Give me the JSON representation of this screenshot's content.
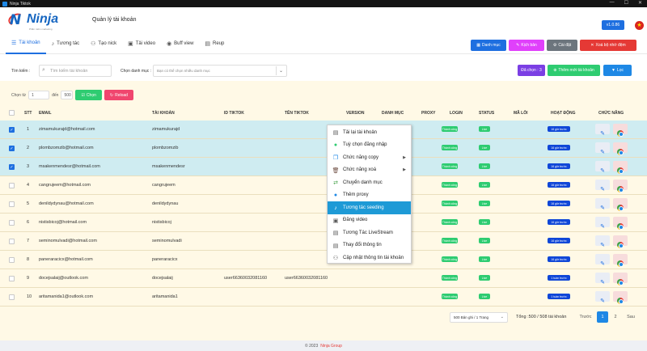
{
  "window": {
    "title": "Ninja Tiktok",
    "controls": [
      "—",
      "☐",
      "✕"
    ]
  },
  "app": {
    "logo_text": "Ninja",
    "logo_tagline": "Phần mềm marketing",
    "page_title": "Quản lý tài khoản",
    "version": "v1.0.86"
  },
  "tabs": [
    {
      "label": "Tài khoản",
      "icon": "list-icon",
      "glyph": "☰"
    },
    {
      "label": "Tương tác",
      "icon": "tiktok-icon",
      "glyph": "♪"
    },
    {
      "label": "Tạo nick",
      "icon": "user-add-icon",
      "glyph": "⚇"
    },
    {
      "label": "Tải video",
      "icon": "video-icon",
      "glyph": "▣"
    },
    {
      "label": "Buff view",
      "icon": "eye-icon",
      "glyph": "◉"
    },
    {
      "label": "Reup",
      "icon": "reup-icon",
      "glyph": "▤"
    }
  ],
  "top_buttons": [
    {
      "label": "Danh mục",
      "color": "#1e6fe0",
      "glyph": "▦"
    },
    {
      "label": "Kịch bản",
      "color": "#e040fb",
      "glyph": "✎"
    },
    {
      "label": "Cài đặt",
      "color": "#6c757d",
      "glyph": "⚙"
    },
    {
      "label": "Xoá bộ nhớ đệm",
      "color": "#e53935",
      "glyph": "✕"
    }
  ],
  "filters": {
    "search_label": "Tìm kiếm :",
    "search_placeholder": "Tìm kiếm tài khoản",
    "category_label": "Chọn danh mục :",
    "category_placeholder": "Bạn có thể chọn nhiều danh mục",
    "selected_badge": "Đã chọn : 3",
    "add_button": "Thêm mới tài khoản",
    "filter_button": "Lọc"
  },
  "range": {
    "from_label": "Chọn từ",
    "from_value": "1",
    "to_label": "đến",
    "to_value": "500",
    "select_button": "Chọn",
    "reload_button": "Reload"
  },
  "columns": [
    "STT",
    "EMAIL",
    "TÀI KHOẢN",
    "ID TIKTOK",
    "TÊN TIKTOK",
    "VERSION",
    "DANH MỤC",
    "PROXY",
    "LOGIN",
    "STATUS",
    "MÃ LỖI",
    "HOẠT ĐỘNG",
    "CHỨC NĂNG"
  ],
  "rows": [
    {
      "stt": "1",
      "email": "zimamukurajd@hotmail.com",
      "account": "zimamukurajd",
      "id_tiktok": "",
      "name_tiktok": "",
      "checked": true,
      "login": "Thành công",
      "status": "Live",
      "activity": "16 giờ trước"
    },
    {
      "stt": "2",
      "email": "plombzomzib@hotmail.com",
      "account": "plombzomzib",
      "id_tiktok": "",
      "name_tiktok": "",
      "checked": true,
      "login": "Thành công",
      "status": "Live",
      "activity": "16 giờ trước"
    },
    {
      "stt": "3",
      "email": "msakenmendesr@hotmail.com",
      "account": "msakenmendesr",
      "id_tiktok": "",
      "name_tiktok": "",
      "checked": true,
      "login": "Thành công",
      "status": "Live",
      "activity": "16 giờ trước"
    },
    {
      "stt": "4",
      "email": "cangrujeem@hotmail.com",
      "account": "cangrujeem",
      "id_tiktok": "",
      "name_tiktok": "",
      "checked": false,
      "login": "Thành công",
      "status": "Live",
      "activity": "16 giờ trước"
    },
    {
      "stt": "5",
      "email": "denildydynau@hotmail.com",
      "account": "denildydynau",
      "id_tiktok": "",
      "name_tiktok": "",
      "checked": false,
      "login": "Thành công",
      "status": "Live",
      "activity": "16 giờ trước"
    },
    {
      "stt": "6",
      "email": "nistisbicoj@hotmail.com",
      "account": "nistisbicoj",
      "id_tiktok": "",
      "name_tiktok": "",
      "checked": false,
      "login": "Thành công",
      "status": "Live",
      "activity": "16 giờ trước"
    },
    {
      "stt": "7",
      "email": "seminomulvadi@hotmail.com",
      "account": "seminomulvadi",
      "id_tiktok": "",
      "name_tiktok": "",
      "checked": false,
      "login": "Thành công",
      "status": "Live",
      "activity": "16 giờ trước"
    },
    {
      "stt": "8",
      "email": "paneraracicx@hotmail.com",
      "account": "paneraracicx",
      "id_tiktok": "",
      "name_tiktok": "",
      "checked": false,
      "login": "Thành công",
      "status": "Live",
      "activity": "16 giờ trước"
    },
    {
      "stt": "9",
      "email": "docejsalaij@outlook.com",
      "account": "docejsalaij",
      "id_tiktok": "user66360032081160",
      "name_tiktok": "user66360032081160",
      "checked": false,
      "login": "Thành công",
      "status": "Live",
      "activity": "1 tuần trước"
    },
    {
      "stt": "10",
      "email": "aritamanida1@outlook.com",
      "account": "aritamanida1",
      "id_tiktok": "",
      "name_tiktok": "",
      "checked": false,
      "login": "Thành công",
      "status": "Live",
      "activity": "1 tuần trước"
    }
  ],
  "context_menu": [
    {
      "label": "Tải lại tài khoản",
      "icon": "reload-icon",
      "glyph": "▤",
      "color": "#555"
    },
    {
      "label": "Tuỳ chọn đăng nhập",
      "icon": "login-option-icon",
      "glyph": "●",
      "color": "#2ecc71"
    },
    {
      "label": "Chức năng copy",
      "icon": "copy-icon",
      "glyph": "❐",
      "color": "#1e88e5",
      "submenu": true
    },
    {
      "label": "Chức năng xoá",
      "icon": "trash-icon",
      "glyph": "🗑",
      "color": "#6d4c41",
      "submenu": true
    },
    {
      "label": "Chuyển danh mục",
      "icon": "move-category-icon",
      "glyph": "⇄",
      "color": "#43a047"
    },
    {
      "label": "Thêm proxy",
      "icon": "proxy-icon",
      "glyph": "●",
      "color": "#1e88e5"
    },
    {
      "label": "Tương tác seeding",
      "icon": "tiktok-seeding-icon",
      "glyph": "♪",
      "color": "#111",
      "highlight": true
    },
    {
      "label": "Đăng video",
      "icon": "upload-video-icon",
      "glyph": "▣",
      "color": "#555"
    },
    {
      "label": "Tương Tác LiveStream",
      "icon": "livestream-icon",
      "glyph": "▤",
      "color": "#555"
    },
    {
      "label": "Thay đổi thông tin",
      "icon": "edit-info-icon",
      "glyph": "▤",
      "color": "#555"
    },
    {
      "label": "Cập nhật thông tin tài khoản",
      "icon": "update-account-icon",
      "glyph": "⚇",
      "color": "#555"
    }
  ],
  "pagination": {
    "page_size": "500 Bản ghi / 1 Trang",
    "total": "Tổng :500 / 508 tài khoản",
    "prev": "Trước",
    "pages": [
      "1",
      "2"
    ],
    "current": "1",
    "next": "Sau"
  },
  "footer": {
    "copyright": "© 2023",
    "brand": "Ninja Group"
  }
}
